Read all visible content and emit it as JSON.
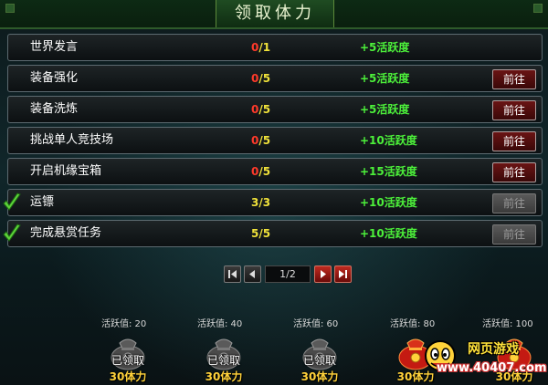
{
  "window": {
    "title": "领取体力"
  },
  "tasks": [
    {
      "name": "世界发言",
      "current": "0",
      "total": "/1",
      "current_color": "red",
      "reward": "+5活跃度",
      "completed": false,
      "button": ""
    },
    {
      "name": "装备强化",
      "current": "0",
      "total": "/5",
      "current_color": "red",
      "reward": "+5活跃度",
      "completed": false,
      "button": "前往"
    },
    {
      "name": "装备洗炼",
      "current": "0",
      "total": "/5",
      "current_color": "red",
      "reward": "+5活跃度",
      "completed": false,
      "button": "前往"
    },
    {
      "name": "挑战单人竞技场",
      "current": "0",
      "total": "/5",
      "current_color": "red",
      "reward": "+10活跃度",
      "completed": false,
      "button": "前往"
    },
    {
      "name": "开启机缘宝箱",
      "current": "0",
      "total": "/5",
      "current_color": "red",
      "reward": "+15活跃度",
      "completed": false,
      "button": "前往"
    },
    {
      "name": "运镖",
      "current": "3",
      "total": "/3",
      "current_color": "yellow",
      "reward": "+10活跃度",
      "completed": true,
      "button": "前往"
    },
    {
      "name": "完成悬赏任务",
      "current": "5",
      "total": "/5",
      "current_color": "yellow",
      "reward": "+10活跃度",
      "completed": true,
      "button": "前往"
    }
  ],
  "pager": {
    "page_text": "1/2"
  },
  "milestones": [
    {
      "label": "活跃值: 20",
      "status": "已领取",
      "reward": "30体力",
      "claimed": true
    },
    {
      "label": "活跃值: 40",
      "status": "已领取",
      "reward": "30体力",
      "claimed": true
    },
    {
      "label": "活跃值: 60",
      "status": "已领取",
      "reward": "30体力",
      "claimed": true
    },
    {
      "label": "活跃值: 80",
      "status": "",
      "reward": "30体力",
      "claimed": false
    },
    {
      "label": "活跃值: 100",
      "status": "",
      "reward": "30体力",
      "claimed": false
    }
  ],
  "watermark": {
    "line1": "网页游戏",
    "line2": "www.40407.com"
  },
  "colors": {
    "reward_green": "#4cf03a",
    "progress_red": "#ff3a2a",
    "progress_yellow": "#f0e23a",
    "gold": "#ffd23a"
  }
}
